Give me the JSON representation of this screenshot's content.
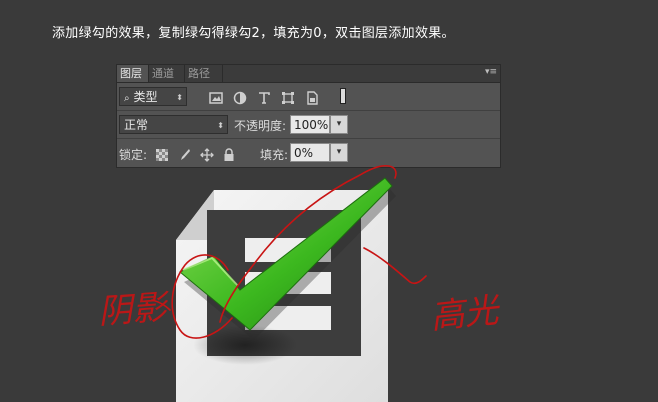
{
  "instruction": "添加绿勾的效果，复制绿勾得绿勾2，填充为0，双击图层添加效果。",
  "panel": {
    "tabs": [
      "图层",
      "通道",
      "路径"
    ],
    "menu_glyph": "▾≡",
    "filter_kind": "类型",
    "filter_icons": [
      "image-filter-icon",
      "adjustment-filter-icon",
      "type-filter-icon",
      "shape-filter-icon",
      "smart-object-filter-icon"
    ],
    "blend_mode": "正常",
    "opacity_label": "不透明度:",
    "opacity_value": "100%",
    "lock_label": "锁定:",
    "lock_icons": [
      "lock-transparent-icon",
      "lock-paint-icon",
      "lock-move-icon",
      "lock-all-icon"
    ],
    "fill_label": "填充:",
    "fill_value": "0%"
  },
  "annotations": {
    "shadow_label": "阴影",
    "highlight_label": "高光"
  },
  "colors": {
    "background": "#3a3a3a",
    "panel": "#535353",
    "checkmark": "#3cb81f",
    "annotation": "#c81414"
  }
}
